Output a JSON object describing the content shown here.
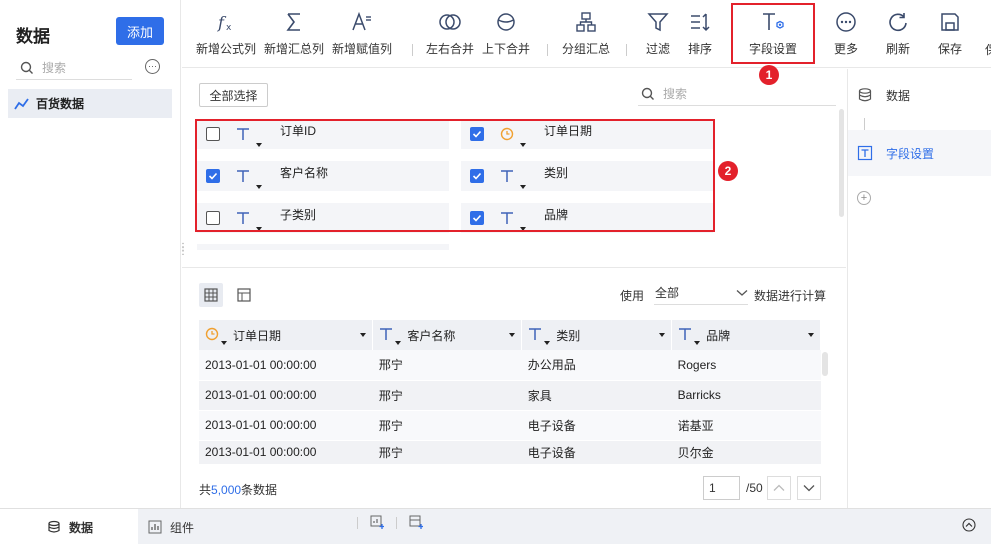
{
  "sidebar": {
    "title": "数据",
    "add_label": "添加",
    "search_placeholder": "搜索",
    "dataset_name": "百货数据"
  },
  "toolbar": {
    "items": [
      {
        "label": "新增公式列",
        "icon": "formula-icon"
      },
      {
        "label": "新增汇总列",
        "icon": "sigma-icon"
      },
      {
        "label": "新增赋值列",
        "icon": "assign-icon"
      },
      {
        "label": "左右合并",
        "icon": "merge-horizontal-icon"
      },
      {
        "label": "上下合并",
        "icon": "merge-vertical-icon"
      },
      {
        "label": "分组汇总",
        "icon": "group-summary-icon"
      },
      {
        "label": "过滤",
        "icon": "filter-icon"
      },
      {
        "label": "排序",
        "icon": "sort-icon"
      },
      {
        "label": "字段设置",
        "icon": "field-settings-icon"
      },
      {
        "label": "更多",
        "icon": "more-icon"
      },
      {
        "label": "刷新",
        "icon": "refresh-icon"
      },
      {
        "label": "保存",
        "icon": "save-icon"
      }
    ],
    "truncated_label": "保"
  },
  "annotations": {
    "badge1": "1",
    "badge2": "2",
    "highlight_color": "#e3212b"
  },
  "fields": {
    "select_all_label": "全部选择",
    "search_placeholder": "搜索",
    "items": [
      {
        "name": "订单ID",
        "checked": false,
        "type": "text"
      },
      {
        "name": "订单日期",
        "checked": true,
        "type": "date"
      },
      {
        "name": "客户名称",
        "checked": true,
        "type": "text"
      },
      {
        "name": "类别",
        "checked": true,
        "type": "text"
      },
      {
        "name": "子类别",
        "checked": false,
        "type": "text"
      },
      {
        "name": "品牌",
        "checked": true,
        "type": "text"
      }
    ]
  },
  "preview": {
    "use_label": "使用",
    "use_value": "全部",
    "use_suffix": "数据进行计算",
    "columns": [
      {
        "name": "订单日期",
        "type": "date"
      },
      {
        "name": "客户名称",
        "type": "text"
      },
      {
        "name": "类别",
        "type": "text"
      },
      {
        "name": "品牌",
        "type": "text"
      }
    ],
    "rows": [
      [
        "2013-01-01 00:00:00",
        "邢宁",
        "办公用品",
        "Rogers"
      ],
      [
        "2013-01-01 00:00:00",
        "邢宁",
        "家具",
        "Barricks"
      ],
      [
        "2013-01-01 00:00:00",
        "邢宁",
        "电子设备",
        "诺基亚"
      ],
      [
        "2013-01-01 00:00:00",
        "邢宁",
        "电子设备",
        "贝尔金"
      ]
    ],
    "total_prefix": "共",
    "total_count": "5,000",
    "total_suffix": "条数据",
    "current_page": "1",
    "total_pages": "/50"
  },
  "steps": {
    "items": [
      {
        "label": "数据",
        "icon": "database-icon"
      },
      {
        "label": "字段设置",
        "icon": "field-settings-icon"
      }
    ]
  },
  "bottom": {
    "tab_data": "数据",
    "tab_component": "组件"
  },
  "colors": {
    "accent": "#2f6ee8",
    "date_icon": "#f0a030"
  }
}
